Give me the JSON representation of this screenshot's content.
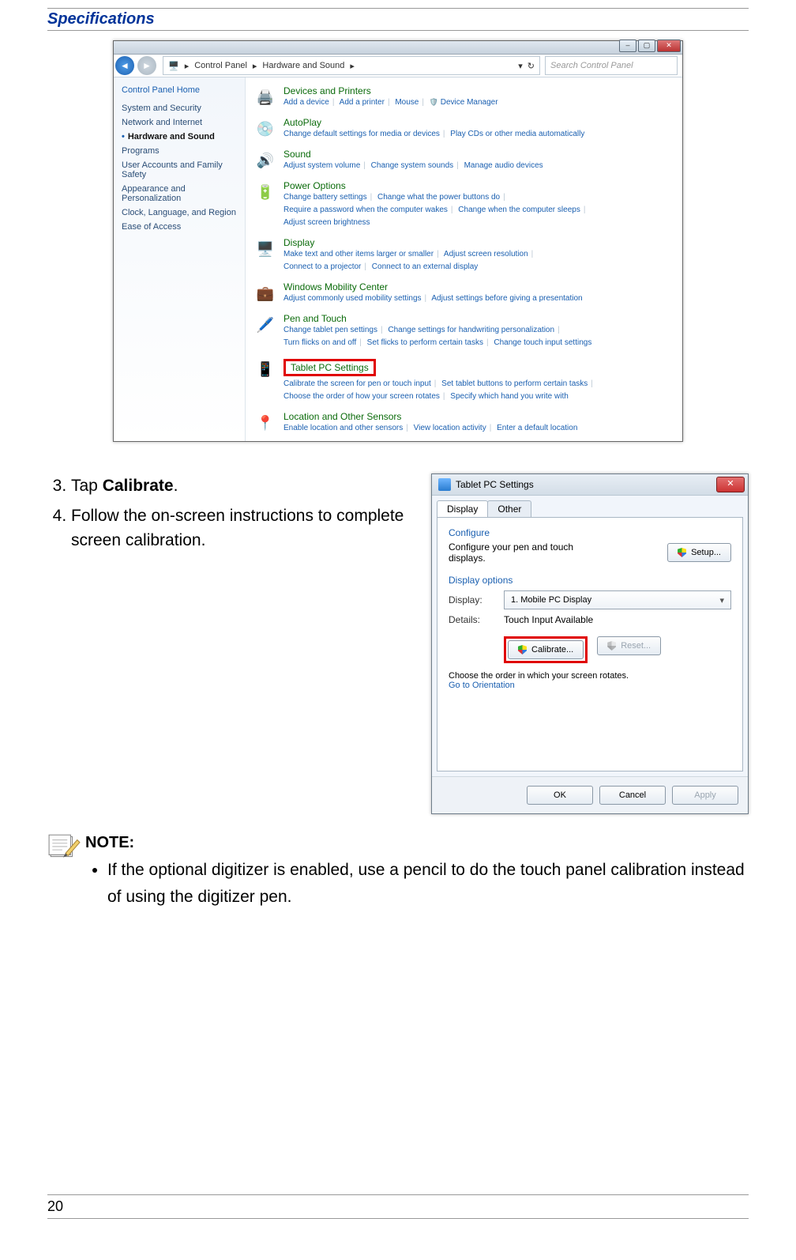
{
  "doc": {
    "section_title": "Specifications",
    "page_number": "20",
    "steps": [
      {
        "num": "3.",
        "pre": "Tap ",
        "bold": "Calibrate",
        "post": "."
      },
      {
        "num": "4.",
        "pre": "Follow the on-screen instructions to complete screen calibration.",
        "bold": "",
        "post": ""
      }
    ],
    "note_label": "NOTE:",
    "note_bullet": "If the optional digitizer is enabled, use a pencil to do the touch panel calibration instead of using the digitizer pen."
  },
  "controlPanel": {
    "path_seg1": "Control Panel",
    "path_seg2": "Hardware and Sound",
    "search_placeholder": "Search Control Panel",
    "side_home": "Control Panel Home",
    "side_items": [
      "System and Security",
      "Network and Internet",
      "Hardware and Sound",
      "Programs",
      "User Accounts and Family Safety",
      "Appearance and Personalization",
      "Clock, Language, and Region",
      "Ease of Access"
    ],
    "groups": {
      "devices": {
        "title": "Devices and Printers",
        "links": [
          "Add a device",
          "Add a printer",
          "Mouse",
          "Device Manager"
        ]
      },
      "autoplay": {
        "title": "AutoPlay",
        "links": [
          "Change default settings for media or devices",
          "Play CDs or other media automatically"
        ]
      },
      "sound": {
        "title": "Sound",
        "links": [
          "Adjust system volume",
          "Change system sounds",
          "Manage audio devices"
        ]
      },
      "power": {
        "title": "Power Options",
        "links": [
          "Change battery settings",
          "Change what the power buttons do",
          "Require a password when the computer wakes",
          "Change when the computer sleeps",
          "Adjust screen brightness"
        ]
      },
      "display": {
        "title": "Display",
        "links": [
          "Make text and other items larger or smaller",
          "Adjust screen resolution",
          "Connect to a projector",
          "Connect to an external display"
        ]
      },
      "mobility": {
        "title": "Windows Mobility Center",
        "links": [
          "Adjust commonly used mobility settings",
          "Adjust settings before giving a presentation"
        ]
      },
      "pen": {
        "title": "Pen and Touch",
        "links": [
          "Change tablet pen settings",
          "Change settings for handwriting personalization",
          "Turn flicks on and off",
          "Set flicks to perform certain tasks",
          "Change touch input settings"
        ]
      },
      "tablet": {
        "title": "Tablet PC Settings",
        "links": [
          "Calibrate the screen for pen or touch input",
          "Set tablet buttons to perform certain tasks",
          "Choose the order of how your screen rotates",
          "Specify which hand you write with"
        ]
      },
      "location": {
        "title": "Location and Other Sensors",
        "links": [
          "Enable location and other sensors",
          "View location activity",
          "Enter a default location"
        ]
      }
    }
  },
  "tabletDlg": {
    "title": "Tablet PC Settings",
    "tab_display": "Display",
    "tab_other": "Other",
    "configure_header": "Configure",
    "configure_text": "Configure your pen and touch displays.",
    "setup_btn": "Setup...",
    "options_header": "Display options",
    "display_label": "Display:",
    "display_value": "1. Mobile PC Display",
    "details_label": "Details:",
    "details_value": "Touch Input Available",
    "calibrate_btn": "Calibrate...",
    "reset_btn": "Reset...",
    "orient_text": "Choose the order in which your screen rotates.",
    "orient_link": "Go to Orientation",
    "ok": "OK",
    "cancel": "Cancel",
    "apply": "Apply"
  }
}
